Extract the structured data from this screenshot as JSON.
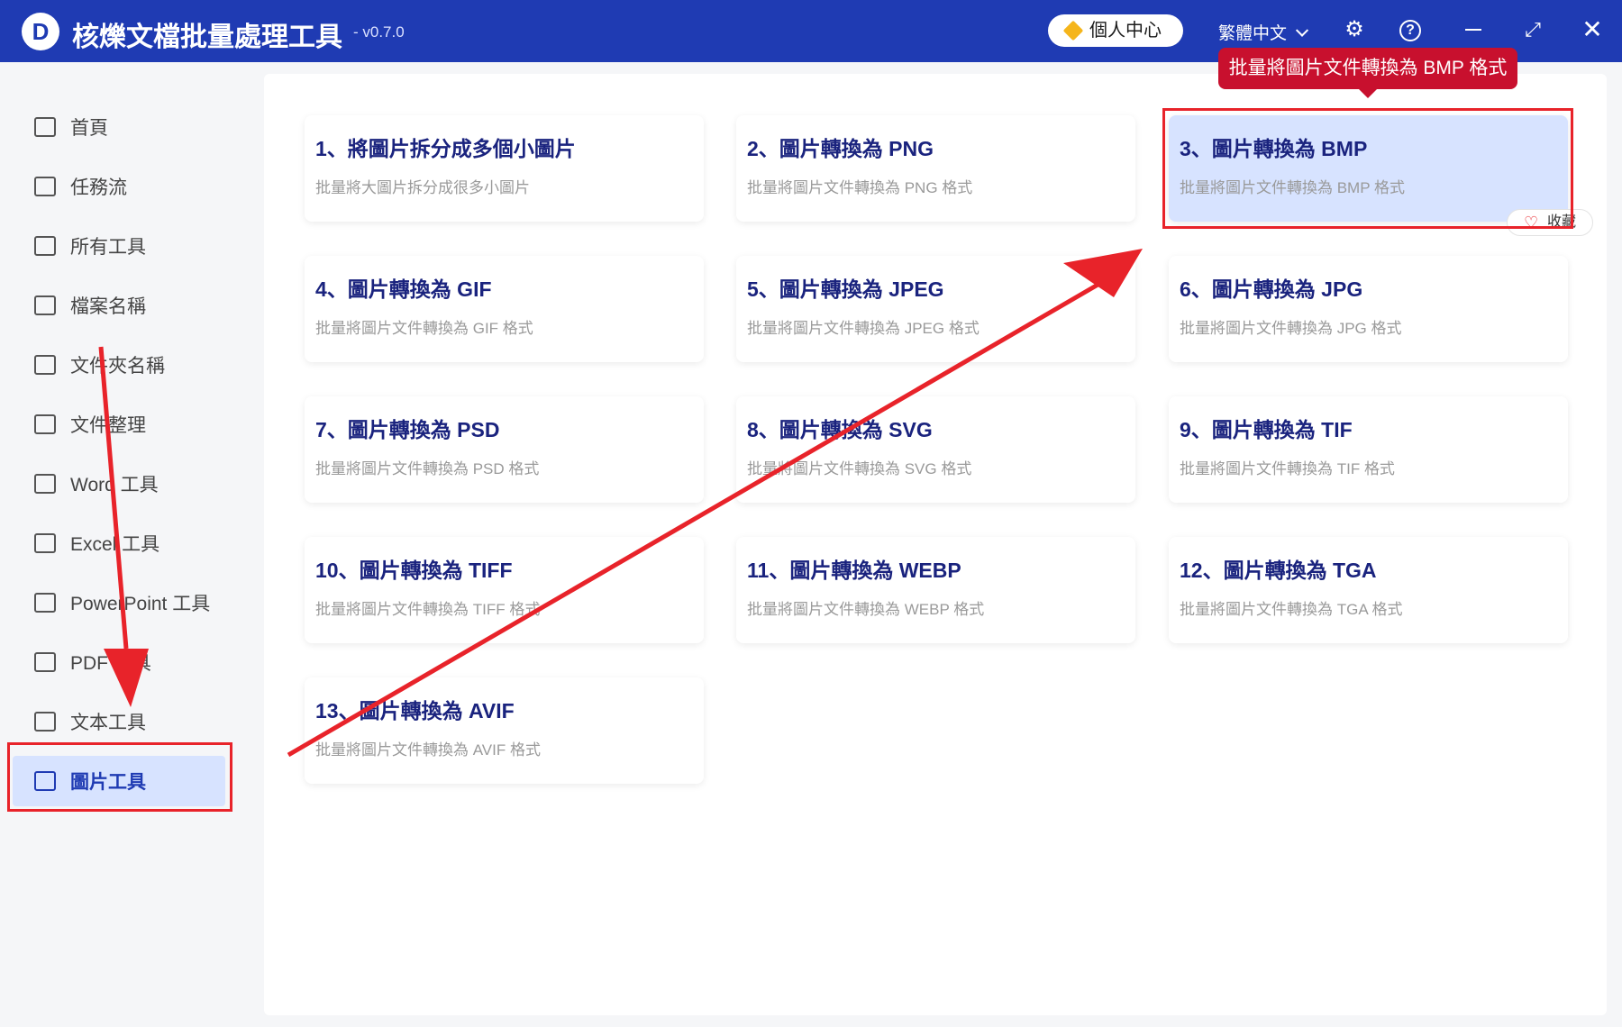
{
  "app": {
    "logo_letter": "D",
    "title": "核爍文檔批量處理工具",
    "version": "- v0.7.0",
    "user_center": "個人中心",
    "language": "繁體中文"
  },
  "sidebar": {
    "items": [
      {
        "label": "首頁",
        "icon": "home-icon"
      },
      {
        "label": "任務流",
        "icon": "workflow-icon"
      },
      {
        "label": "所有工具",
        "icon": "monitor-icon"
      },
      {
        "label": "檔案名稱",
        "icon": "file-name-icon"
      },
      {
        "label": "文件夾名稱",
        "icon": "folder-icon"
      },
      {
        "label": "文件整理",
        "icon": "organize-icon"
      },
      {
        "label": "Word 工具",
        "icon": "word-icon"
      },
      {
        "label": "Excel 工具",
        "icon": "excel-icon"
      },
      {
        "label": "PowerPoint 工具",
        "icon": "powerpoint-icon"
      },
      {
        "label": "PDF 工具",
        "icon": "pdf-icon"
      },
      {
        "label": "文本工具",
        "icon": "text-icon"
      },
      {
        "label": "圖片工具",
        "icon": "image-icon",
        "active": true
      }
    ]
  },
  "cards": [
    {
      "title": "1、將圖片拆分成多個小圖片",
      "desc": "批量將大圖片拆分成很多小圖片"
    },
    {
      "title": "2、圖片轉換為 PNG",
      "desc": "批量將圖片文件轉換為 PNG 格式"
    },
    {
      "title": "3、圖片轉換為 BMP",
      "desc": "批量將圖片文件轉換為 BMP 格式"
    },
    {
      "title": "4、圖片轉換為 GIF",
      "desc": "批量將圖片文件轉換為 GIF 格式"
    },
    {
      "title": "5、圖片轉換為 JPEG",
      "desc": "批量將圖片文件轉換為 JPEG 格式"
    },
    {
      "title": "6、圖片轉換為 JPG",
      "desc": "批量將圖片文件轉換為 JPG 格式"
    },
    {
      "title": "7、圖片轉換為 PSD",
      "desc": "批量將圖片文件轉換為 PSD 格式"
    },
    {
      "title": "8、圖片轉換為 SVG",
      "desc": "批量將圖片文件轉換為 SVG 格式"
    },
    {
      "title": "9、圖片轉換為 TIF",
      "desc": "批量將圖片文件轉換為 TIF 格式"
    },
    {
      "title": "10、圖片轉換為 TIFF",
      "desc": "批量將圖片文件轉換為 TIFF 格式"
    },
    {
      "title": "11、圖片轉換為 WEBP",
      "desc": "批量將圖片文件轉換為 WEBP 格式"
    },
    {
      "title": "12、圖片轉換為 TGA",
      "desc": "批量將圖片文件轉換為 TGA 格式"
    },
    {
      "title": "13、圖片轉換為 AVIF",
      "desc": "批量將圖片文件轉換為 AVIF 格式"
    }
  ],
  "favorite_label": "收藏",
  "tooltip": "批量將圖片文件轉換為 BMP 格式",
  "colors": {
    "accent": "#1f3bb3",
    "highlight": "#e8232a",
    "active_bg": "#d7e3ff"
  }
}
